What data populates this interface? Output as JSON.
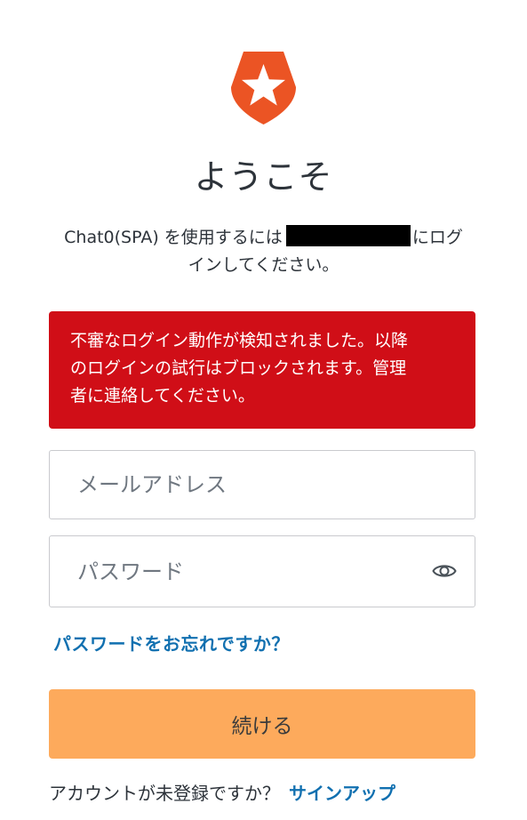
{
  "header": {
    "title": "ようこそ",
    "subtitle_before": "Chat0(SPA) を使用するには",
    "subtitle_after_line1": "にログ",
    "subtitle_line2": "インしてください。"
  },
  "alert": {
    "line1": "不審なログイン動作が検知されました。以降",
    "line2": "のログインの試行はブロックされます。管理",
    "line3": "者に連絡してください。"
  },
  "form": {
    "email_placeholder": "メールアドレス",
    "password_placeholder": "パスワード",
    "forgot_label": "パスワードをお忘れですか？",
    "continue_label": "続ける"
  },
  "footer": {
    "signup_prompt": "アカウントが未登録ですか？",
    "signup_link": "サインアップ"
  },
  "colors": {
    "logo": "#eb5424",
    "alert_bg": "#d00e17",
    "link": "#1170b0",
    "button_bg": "#fdaa5c"
  },
  "icons": {
    "logo": "shield-star-logo",
    "password_toggle": "eye-icon"
  }
}
